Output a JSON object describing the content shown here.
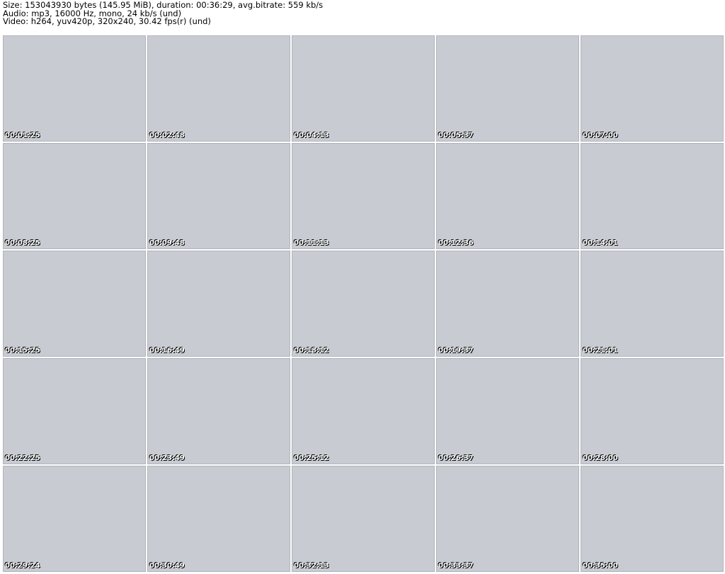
{
  "meta": {
    "file": "",
    "size": "Size: 153043930 bytes (145.95 MiB), duration: 00:36:29, avg.bitrate: 559 kb/s",
    "audio": "Audio: mp3, 16000 Hz, mono, 24 kb/s (und)",
    "video": "Video: h264, yuv420p, 320x240, 30.42 fps(r) (und)"
  },
  "timestamps": [
    "00:01:25",
    "00:02:48",
    "00:04:13",
    "00:05:37",
    "00:07:00",
    "00:08:25",
    "00:09:48",
    "00:11:13",
    "00:12:36",
    "00:14:01",
    "00:15:25",
    "00:16:49",
    "00:18:12",
    "00:19:37",
    "00:21:01",
    "00:22:25",
    "00:23:49",
    "00:25:12",
    "00:26:37",
    "00:28:00",
    "00:29:24",
    "00:30:49",
    "00:32:13",
    "00:33:37",
    "00:35:00"
  ]
}
